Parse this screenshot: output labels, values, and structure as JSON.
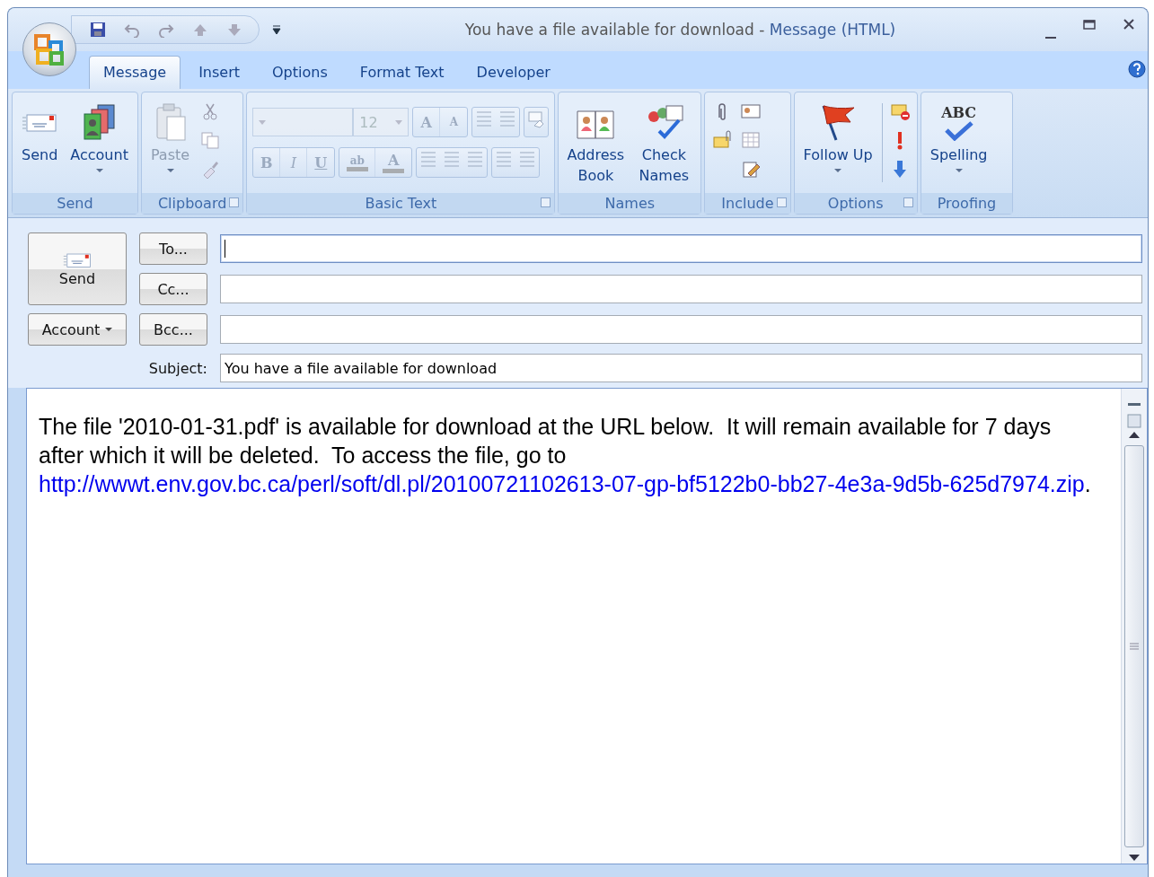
{
  "window": {
    "title": "You have a file available for download",
    "separator": "-",
    "application": "Message (HTML)"
  },
  "tabs": [
    {
      "label": "Message",
      "selected": true
    },
    {
      "label": "Insert",
      "selected": false
    },
    {
      "label": "Options",
      "selected": false
    },
    {
      "label": "Format Text",
      "selected": false
    },
    {
      "label": "Developer",
      "selected": false
    }
  ],
  "ribbon": {
    "groups": [
      {
        "label": "Send",
        "buttons": [
          {
            "label": "Send"
          },
          {
            "label": "Account",
            "dropdown": true
          }
        ]
      },
      {
        "label": "Clipboard",
        "launcher": true,
        "buttons": [
          {
            "label": "Paste",
            "dropdown": true,
            "disabled": true
          }
        ]
      },
      {
        "label": "Basic Text",
        "launcher": true
      },
      {
        "label": "Names",
        "buttons": [
          {
            "label": "Address Book"
          },
          {
            "label": "Check Names"
          }
        ]
      },
      {
        "label": "Include",
        "launcher": true
      },
      {
        "label": "Options",
        "launcher": true,
        "buttons": [
          {
            "label": "Follow Up",
            "dropdown": true
          }
        ]
      },
      {
        "label": "Proofing",
        "buttons": [
          {
            "label": "Spelling",
            "dropdown": true
          }
        ]
      }
    ],
    "basic_text": {
      "disabled": true,
      "font_size": "12",
      "grow_font": "A",
      "shrink_font": "A",
      "bold": "B",
      "italic": "I",
      "underline": "U",
      "highlight": "ab",
      "font_color": "A"
    },
    "spelling_glyph": "ABC"
  },
  "compose": {
    "send": "Send",
    "account": "Account",
    "recipients": [
      {
        "button": "To...",
        "focused": true
      },
      {
        "button": "Cc...",
        "focused": false
      },
      {
        "button": "Bcc...",
        "focused": false
      }
    ],
    "subject_label": "Subject:",
    "subject": "You have a file available for download"
  },
  "body": {
    "text": "The file '2010-01-31.pdf' is available for download at the URL below.  It will remain available for 7 days after which it will be deleted.  To access the file, go to",
    "link": "http://wwwt.env.gov.bc.ca/perl/soft/dl.pl/20100721102613-07-gp-bf5122b0-bb27-4e3a-9d5b-625d7974.zip",
    "after": "."
  }
}
